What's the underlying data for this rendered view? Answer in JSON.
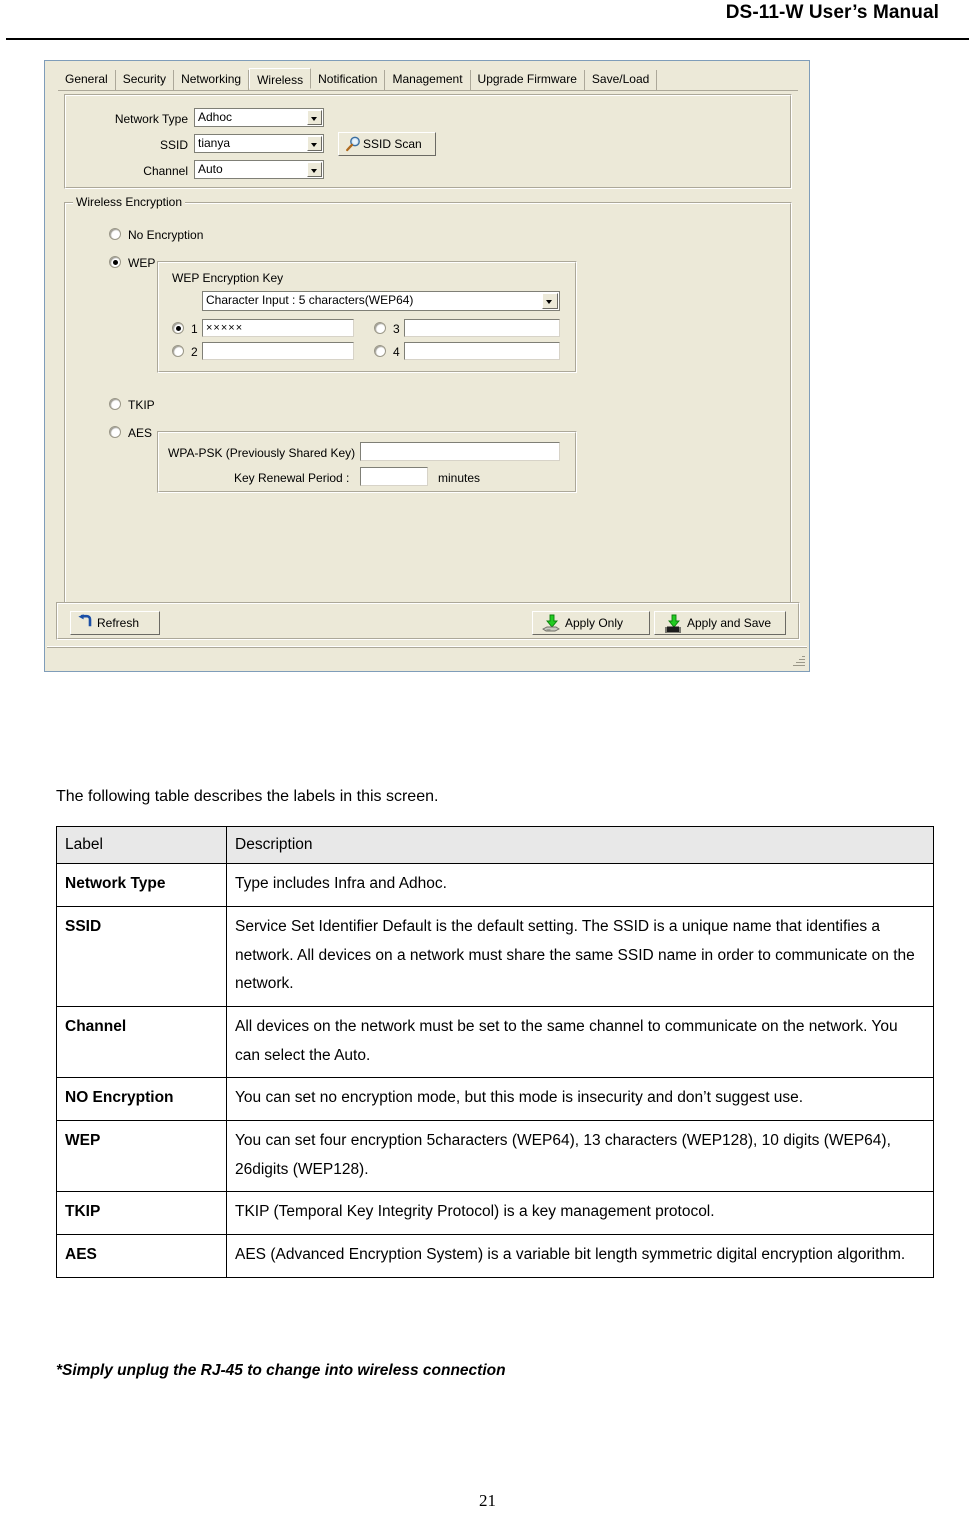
{
  "header": {
    "title": "DS-11-W User’s Manual"
  },
  "footer": {
    "page_number": "21"
  },
  "screenshot": {
    "tabs": [
      {
        "label": "General",
        "active": false
      },
      {
        "label": "Security",
        "active": false
      },
      {
        "label": "Networking",
        "active": false
      },
      {
        "label": "Wireless",
        "active": true
      },
      {
        "label": "Notification",
        "active": false
      },
      {
        "label": "Management",
        "active": false
      },
      {
        "label": "Upgrade Firmware",
        "active": false
      },
      {
        "label": "Save/Load",
        "active": false
      }
    ],
    "top_panel": {
      "network_type": {
        "label": "Network Type",
        "value": "Adhoc"
      },
      "ssid": {
        "label": "SSID",
        "value": "tianya"
      },
      "channel": {
        "label": "Channel",
        "value": "Auto"
      },
      "ssid_scan_button": "SSID Scan"
    },
    "wireless_encryption": {
      "caption": "Wireless Encryption",
      "no_encryption": {
        "label": "No Encryption",
        "checked": false
      },
      "wep": {
        "label": "WEP",
        "checked": true
      },
      "tkip": {
        "label": "TKIP",
        "checked": false
      },
      "aes": {
        "label": "AES",
        "checked": false
      },
      "wep_group": {
        "caption": "WEP Encryption Key",
        "key_type": "Character Input : 5 characters(WEP64)",
        "keys": [
          {
            "index": "1",
            "checked": true,
            "value": "×××××"
          },
          {
            "index": "2",
            "checked": false,
            "value": ""
          },
          {
            "index": "3",
            "checked": false,
            "value": ""
          },
          {
            "index": "4",
            "checked": false,
            "value": ""
          }
        ]
      },
      "wpa_group": {
        "psk_label": "WPA-PSK (Previously Shared Key)",
        "psk_value": "",
        "renewal_label": "Key Renewal Period :",
        "renewal_value": "",
        "renewal_units": "minutes"
      }
    },
    "command_bar": {
      "refresh": "Refresh",
      "apply_only": "Apply Only",
      "apply_and_save": "Apply and Save"
    }
  },
  "body": {
    "intro": "The following table describes the labels in this screen.",
    "table": {
      "headers": [
        "Label",
        "Description"
      ],
      "rows": [
        {
          "label": "Network Type",
          "description": "Type includes Infra and Adhoc."
        },
        {
          "label": "SSID",
          "description": "Service Set Identifier Default is the default setting.    The SSID is a unique name that identifies a network.    All devices on a network must share the same SSID name in order to communicate on the network."
        },
        {
          "label": "Channel",
          "description": "All devices on the network must be set to the same channel to communicate on the network.    You can select the Auto."
        },
        {
          "label": "NO Encryption",
          "description": "You can set no encryption mode, but this mode is insecurity and don’t suggest use."
        },
        {
          "label": "WEP",
          "description": "You can set four encryption 5characters (WEP64), 13 characters (WEP128), 10 digits (WEP64), 26digits (WEP128)."
        },
        {
          "label": "TKIP",
          "description": "TKIP (Temporal Key Integrity Protocol) is a key management protocol."
        },
        {
          "label": "AES",
          "description": "AES (Advanced Encryption System) is a variable bit length symmetric digital encryption algorithm."
        }
      ]
    },
    "footnote": "*Simply unplug the RJ-45 to change into wireless connection"
  }
}
